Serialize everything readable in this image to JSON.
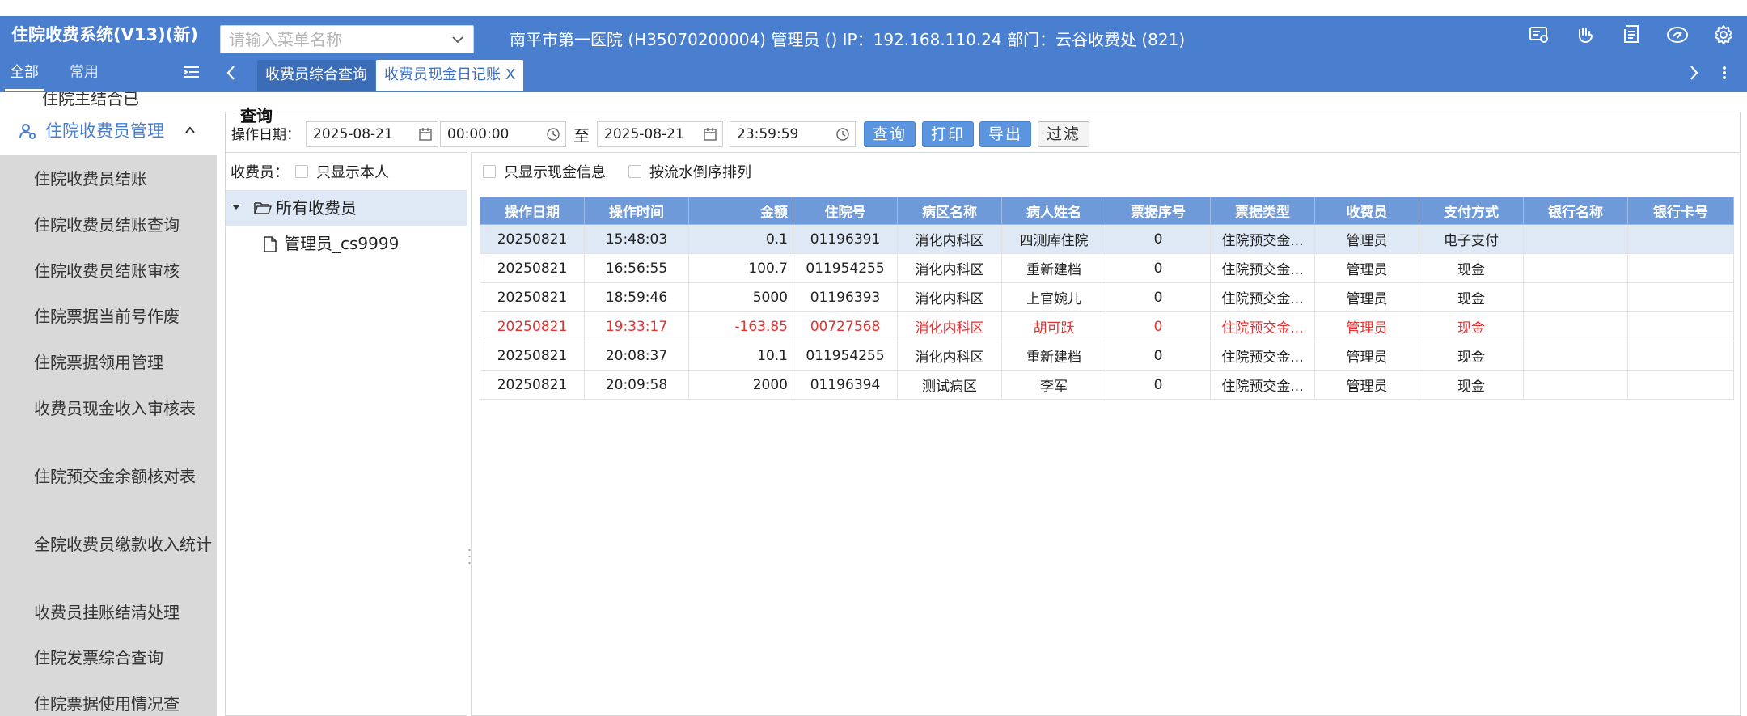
{
  "app": {
    "title": "住院收费系统(V13)(新)",
    "menu_search_placeholder": "请输入菜单名称",
    "hospital_info": "南平市第一医院 (H35070200004) 管理员 () IP：192.168.110.24 部门：云谷收费处 (821)",
    "toolbar_icons": [
      "message-icon",
      "hand-icon",
      "document-icon",
      "brand-icon",
      "gear-icon"
    ]
  },
  "side_tabs": {
    "all": "全部",
    "common": "常用"
  },
  "tabs": [
    {
      "label": "收费员综合查询"
    },
    {
      "label": "收费员现金日记账",
      "close": "X"
    }
  ],
  "sidebar": {
    "cut_item": "住院主结合已",
    "group": "住院收费员管理",
    "items": [
      "住院收费员结账",
      "住院收费员结账查询",
      "住院收费员结账审核",
      "住院票据当前号作废",
      "住院票据领用管理",
      "收费员现金收入审核表",
      "住院预交金余额核对表",
      "全院收费员缴款收入统计",
      "收费员挂账结清处理",
      "住院发票综合查询",
      "住院票据使用情况查"
    ]
  },
  "query": {
    "legend": "查询",
    "date_label": "操作日期：",
    "start_date": "2025-08-21",
    "start_time": "00:00:00",
    "to": "至",
    "end_date": "2025-08-21",
    "end_time": "23:59:59",
    "buttons": {
      "search": "查询",
      "print": "打印",
      "export": "导出",
      "filter": "过滤"
    }
  },
  "left_pane": {
    "cashier_label": "收费员：",
    "only_self": "只显示本人",
    "tree_root": "所有收费员",
    "tree_leaf": "管理员_cs9999"
  },
  "right_pane": {
    "only_cash": "只显示现金信息",
    "desc_sort": "按流水倒序排列"
  },
  "table": {
    "columns": [
      "操作日期",
      "操作时间",
      "金额",
      "住院号",
      "病区名称",
      "病人姓名",
      "票据序号",
      "票据类型",
      "收费员",
      "支付方式",
      "银行名称",
      "银行卡号"
    ],
    "rows": [
      {
        "date": "20250821",
        "time": "15:48:03",
        "amount": "0.1",
        "inpatient_no": "01196391",
        "ward": "消化内科区",
        "patient": "四测库住院",
        "seq": "0",
        "type": "住院预交金...",
        "cashier": "管理员",
        "pay": "电子支付",
        "bank": "",
        "card": "",
        "style": "selected"
      },
      {
        "date": "20250821",
        "time": "16:56:55",
        "amount": "100.7",
        "inpatient_no": "011954255",
        "ward": "消化内科区",
        "patient": "重新建档",
        "seq": "0",
        "type": "住院预交金...",
        "cashier": "管理员",
        "pay": "现金",
        "bank": "",
        "card": "",
        "style": ""
      },
      {
        "date": "20250821",
        "time": "18:59:46",
        "amount": "5000",
        "inpatient_no": "01196393",
        "ward": "消化内科区",
        "patient": "上官婉儿",
        "seq": "0",
        "type": "住院预交金...",
        "cashier": "管理员",
        "pay": "现金",
        "bank": "",
        "card": "",
        "style": ""
      },
      {
        "date": "20250821",
        "time": "19:33:17",
        "amount": "-163.85",
        "inpatient_no": "00727568",
        "ward": "消化内科区",
        "patient": "胡可跃",
        "seq": "0",
        "type": "住院预交金...",
        "cashier": "管理员",
        "pay": "现金",
        "bank": "",
        "card": "",
        "style": "red"
      },
      {
        "date": "20250821",
        "time": "20:08:37",
        "amount": "10.1",
        "inpatient_no": "011954255",
        "ward": "消化内科区",
        "patient": "重新建档",
        "seq": "0",
        "type": "住院预交金...",
        "cashier": "管理员",
        "pay": "现金",
        "bank": "",
        "card": "",
        "style": ""
      },
      {
        "date": "20250821",
        "time": "20:09:58",
        "amount": "2000",
        "inpatient_no": "01196394",
        "ward": "测试病区",
        "patient": "李军",
        "seq": "0",
        "type": "住院预交金...",
        "cashier": "管理员",
        "pay": "现金",
        "bank": "",
        "card": "",
        "style": ""
      }
    ]
  },
  "colors": {
    "primary": "#4a7fd0",
    "selected_row": "#dfe8f5",
    "negative": "#e53030",
    "header": "#6f9ad9"
  }
}
